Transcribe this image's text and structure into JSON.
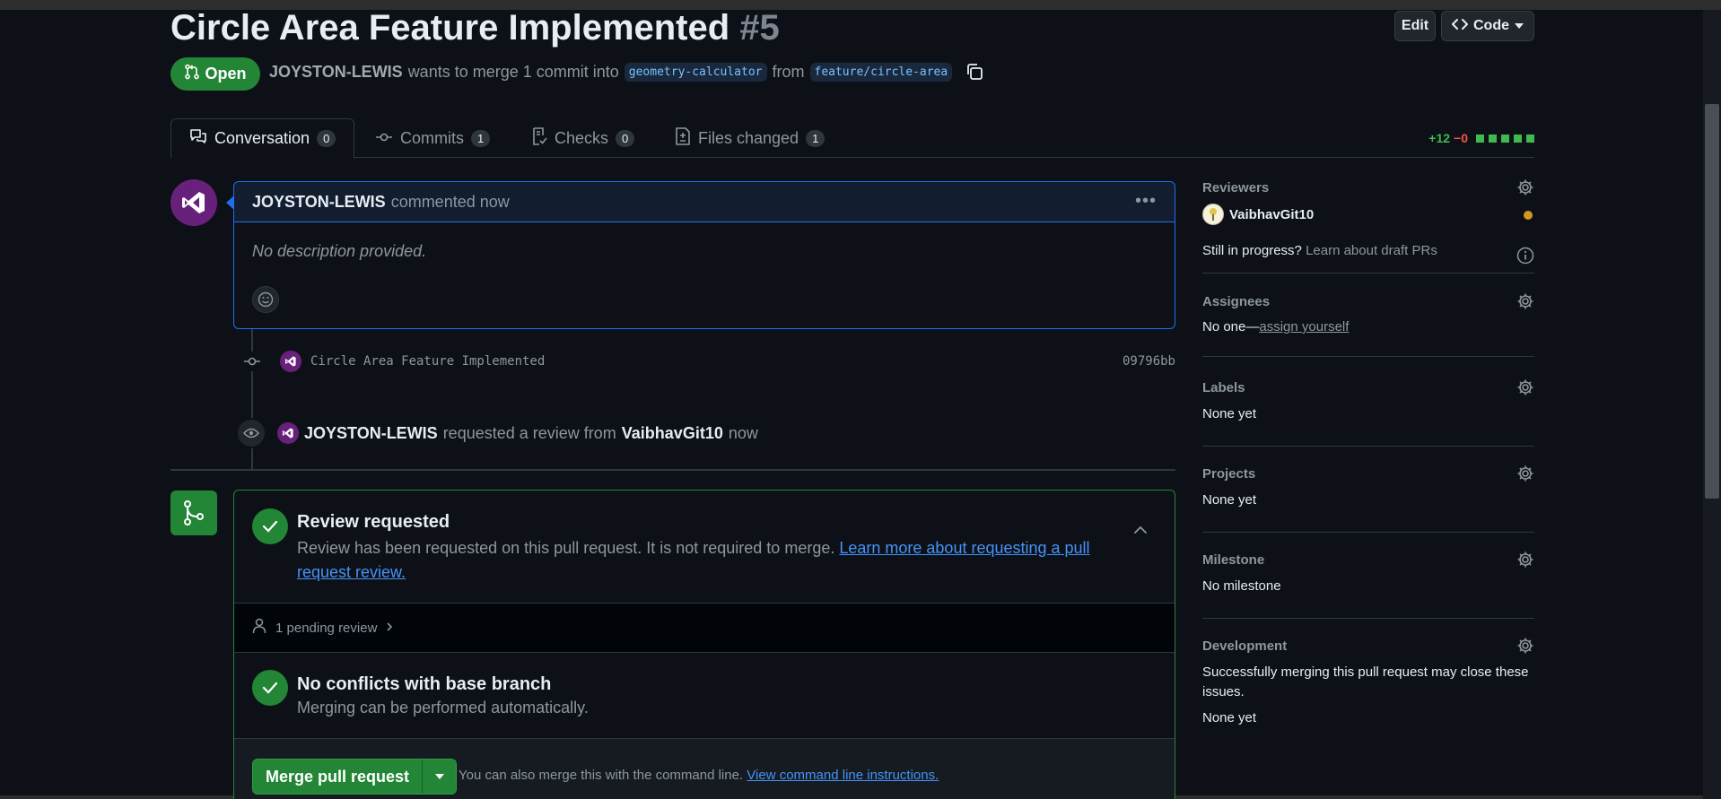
{
  "header": {
    "title": "Circle Area Feature Implemented",
    "number": "#5",
    "edit_label": "Edit",
    "code_label": "Code",
    "state": "Open",
    "author": "JOYSTON-LEWIS",
    "merge_text": "wants to merge 1 commit into",
    "base_branch": "geometry-calculator",
    "from_text": "from",
    "head_branch": "feature/circle-area"
  },
  "tabs": [
    {
      "label": "Conversation",
      "count": "0",
      "icon": "comment-discussion-icon"
    },
    {
      "label": "Commits",
      "count": "1",
      "icon": "git-commit-icon"
    },
    {
      "label": "Checks",
      "count": "0",
      "icon": "checklist-icon"
    },
    {
      "label": "Files changed",
      "count": "1",
      "icon": "file-diff-icon"
    }
  ],
  "diffstat": {
    "additions": "+12",
    "deletions": "−0"
  },
  "comment": {
    "author": "JOYSTON-LEWIS",
    "time": "commented now",
    "body": "No description provided."
  },
  "commit": {
    "message": "Circle Area Feature Implemented",
    "sha": "09796bb"
  },
  "review_event": {
    "author": "JOYSTON-LEWIS",
    "text": "requested a review from",
    "reviewer": "VaibhavGit10",
    "time": "now"
  },
  "merge_box": {
    "review_title": "Review requested",
    "review_desc": "Review has been requested on this pull request. It is not required to merge.",
    "review_link": "Learn more about requesting a pull request review.",
    "pending": "1 pending review",
    "conflicts_title": "No conflicts with base branch",
    "conflicts_desc": "Merging can be performed automatically.",
    "merge_button": "Merge pull request",
    "hint": "You can also merge this with the command line.",
    "hint_link": "View command line instructions."
  },
  "sidebar": {
    "reviewers": {
      "heading": "Reviewers",
      "name": "VaibhavGit10",
      "draft_q": "Still in progress?",
      "draft_link": "Learn about draft PRs"
    },
    "assignees": {
      "heading": "Assignees",
      "none": "No one—",
      "link": "assign yourself"
    },
    "labels": {
      "heading": "Labels",
      "value": "None yet"
    },
    "projects": {
      "heading": "Projects",
      "value": "None yet"
    },
    "milestone": {
      "heading": "Milestone",
      "value": "No milestone"
    },
    "development": {
      "heading": "Development",
      "desc": "Successfully merging this pull request may close these issues.",
      "value": "None yet"
    }
  },
  "colors": {
    "accent": "#1f6feb",
    "success": "#238636",
    "link": "#4493f8",
    "pending": "#d29922"
  }
}
